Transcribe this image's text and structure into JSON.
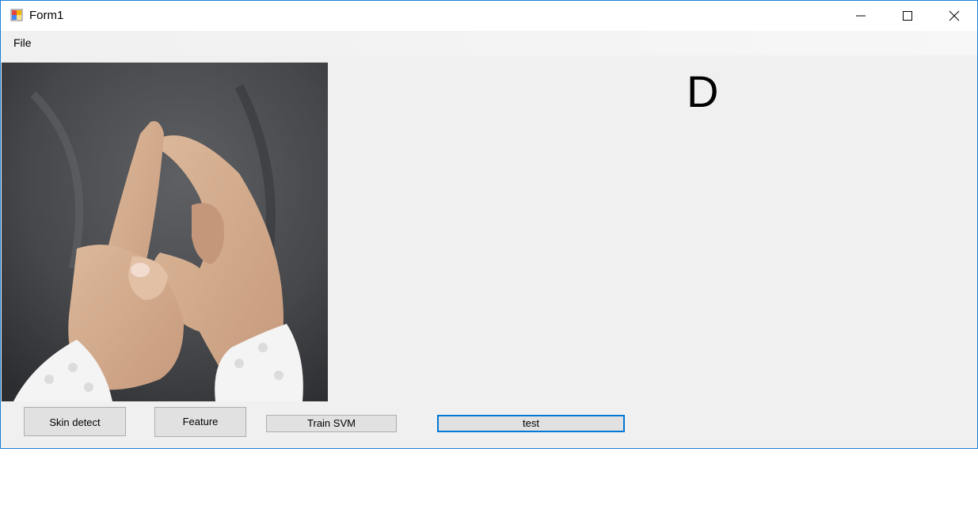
{
  "window": {
    "title": "Form1"
  },
  "menu": {
    "file_label": "File"
  },
  "result": {
    "letter": "D"
  },
  "buttons": {
    "skin_detect": "Skin detect",
    "feature": "Feature",
    "train_svm": "Train SVM",
    "test": "test"
  },
  "colors": {
    "accent": "#0078d7",
    "window_bg": "#f0f0f0"
  },
  "icons": [
    "app-icon",
    "minimize-icon",
    "maximize-icon",
    "close-icon"
  ]
}
